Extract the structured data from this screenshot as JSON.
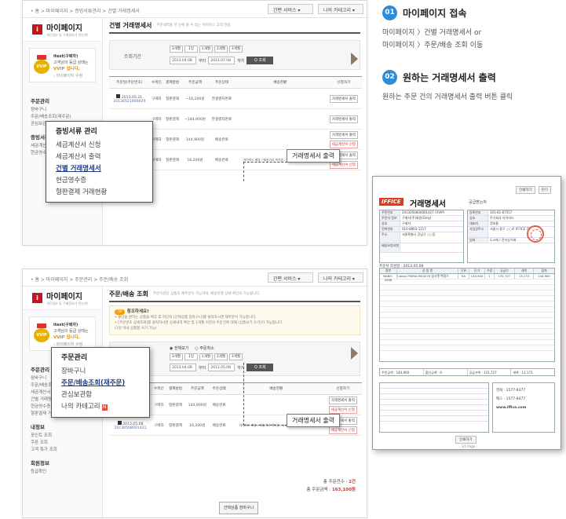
{
  "steps": [
    {
      "num": "01",
      "title": "마이페이지 접속",
      "lines": [
        "마이페이지 〉건별 거래명세서 or",
        "마이페이지 〉주문/배송 조회 이동"
      ]
    },
    {
      "num": "02",
      "title": "원하는 거래명세서 출력",
      "lines": [
        "원하는 주문 건의 거래명세서 출력 버튼 클릭"
      ]
    }
  ],
  "shot1": {
    "breadcrumb": "• 홈 > 마이페이지 > 증빙서류관리 > 건별 거래명세서",
    "top_btn1": "간편 서비스 ▾",
    "top_btn2": "나의 카테고리 ▾",
    "logo_mark": "i",
    "logo_text": "마이페이지",
    "logo_sub": "개인정보 및 구매정보가 한눈에!",
    "user": {
      "name": "itest(구매자)",
      "line2": "고객님의 등급 상태는",
      "grade": "VVIP 입니다.",
      "link": "› 마이페이지 수정"
    },
    "side_h1": "주문관리",
    "side_items1": [
      "장바구니",
      "주문/배송조회(재주문)",
      "관심보관함"
    ],
    "side_h2": "증빙서류",
    "side_items2": [
      "세금계산서",
      "현금영수증"
    ],
    "page_title": "건별 거래명세서",
    "page_sub": "주문내역을 한 눈에 볼 수 있는 아이마스 고객 전용",
    "period_label": "조회기간",
    "period_btns": [
      "3개월",
      "1일",
      "1개월",
      "2개월",
      "3개월"
    ],
    "date_from": "2013.04.08",
    "date_to": "2013.07.08",
    "from_label": "부터",
    "to_label": "까지",
    "query_btn": "Q 조회",
    "columns": [
      "주문일(주문번호)",
      "수취인",
      "결제방법",
      "주문금액",
      "주문상태",
      "배송현황",
      "신청하기"
    ],
    "rows": [
      {
        "date": "2013.05.21",
        "no": "20130521000024",
        "recv": "구매자",
        "pay": "형판결제",
        "amount": "~16,200원",
        "status": "한결결자완료",
        "ship": "",
        "btns": [
          "거래명세서 출력"
        ]
      },
      {
        "date": "",
        "no": "",
        "recv": "구매자",
        "pay": "형판결제",
        "amount": "~144,900원",
        "status": "한결결자완료",
        "ship": "",
        "btns": [
          "거래명세서 출력"
        ]
      },
      {
        "date": "",
        "no": "",
        "recv": "구매자",
        "pay": "형판결제",
        "amount": "144,900원",
        "status": "배송완료",
        "ship": "",
        "btns": [
          "거래명세서 출력",
          "세금계산서 신청"
        ]
      },
      {
        "date": "",
        "no": "",
        "recv": "구매자",
        "pay": "형판결제",
        "amount": "16,200원",
        "status": "배송완료",
        "ship": "아이마스 배송 / 배송기사 박지승 / (H.P.010-8942-3670)",
        "btns": [
          "거래명세서 출력",
          "세금계산서 신청"
        ]
      }
    ],
    "popup_title": "증빙서류 관리",
    "popup_items": [
      "세금계산서 신청",
      "세금계산서 출력",
      "건별 거래명세서",
      "현금영수증",
      "형판결제 거래현황"
    ],
    "callout": "거래명세서 출력"
  },
  "shot2": {
    "breadcrumb": "• 홈 > 마이페이지 > 주문관리 > 주문/배송 조회",
    "top_btn1": "간편 서비스 ▾",
    "top_btn2": "나의 카테고리 ▾",
    "logo_mark": "i",
    "logo_text": "마이페이지",
    "logo_sub": "개인정보 및 구매정보가 한눈에!",
    "user": {
      "name": "itest(구매자)",
      "line2": "고객님의 등급 상태는",
      "grade": "VVIP 입니다.",
      "link": "› 마이페이지 수정"
    },
    "side_h1": "주문관리",
    "side_items1": [
      "장바구니",
      "주문/배송조회",
      "세금계산서 출력",
      "건별 거래명세서",
      "현금영수증",
      "형판결제 거래현황"
    ],
    "side_h2": "내정보",
    "side_items2": [
      "포인트 조회",
      "쿠폰 조회",
      "고객 특가 조회"
    ],
    "side_h3": "회원정보",
    "side_items3": [
      "등급확인"
    ],
    "page_title": "주문/배송 조회",
    "page_sub": "주문하셨던 상품의 재주문이 가능하며, 배송진행 상태 확인이 가능합니다.",
    "tip_tag": "TIP",
    "tip_title": "참조하세요!",
    "tip_lines": [
      "• 출단을 원하는 상품을 체크 후 하단의 [선택상품 장바구니]를 클릭하시면 재주문이 가능합니다.",
      "• [주문번호 상세조회]를 클릭하시면 상세내역 확인 및 1개월 이전의 주문건에 대해 (상품보기 쓰기)가 가능합니다.",
      "(1일 이내 상품평 쓰기 가능)"
    ],
    "radio1": "전체보기",
    "radio2": "주문취소",
    "period_btns": [
      "3개월",
      "1일",
      "1개월",
      "2개월",
      "3개월"
    ],
    "date_from": "2013.04.08",
    "date_to": "2013.05.08",
    "from_label": "부터",
    "to_label": "까지",
    "query_btn": "Q 조회",
    "columns": [
      "주문일(주문번호)",
      "수취인",
      "결제방법",
      "주문금액",
      "주문상태",
      "배송현황",
      "신청하기"
    ],
    "rows": [
      {
        "date": "2013.05.21",
        "no": "20130508001422",
        "recv": "구매자",
        "pay": "형판결제",
        "amount": "144,900원",
        "status": "배송완료",
        "ship": "",
        "btns": [
          "거래명세서 출력",
          "세금계산서 신청"
        ]
      },
      {
        "date": "2013.05.08",
        "no": "20130508001421",
        "recv": "구매자",
        "pay": "형판결제",
        "amount": "16,200원",
        "status": "배송완료",
        "ship": "아이마스 배송 / 배송기사 박지승 / (H.P.010-8942-3670)",
        "btns": [
          "거래명세서 출력",
          "세금계산서 신청"
        ]
      }
    ],
    "total_count_label": "총 주문건수 :",
    "total_count": "2건",
    "total_amount_label": "총 주문금액 :",
    "total_amount": "163,100원",
    "cart_btn": "선택상품 장바구니",
    "popup_title": "주문관리",
    "popup_items": [
      "장바구니",
      "주문/배송조회(재주문)",
      "관심보관함",
      "나의 카테고리"
    ],
    "popup_hot": "N",
    "callout": "거래명세서 출력"
  },
  "invoice": {
    "tool1": "인쇄하기",
    "tool2": "닫기",
    "brand": "IFFICE",
    "title": "거래명세서",
    "no_label": "공급받는자",
    "supplier_rows": [
      {
        "k": "주문번호",
        "v": "2013050800001427 (VVIP)"
      },
      {
        "k": "주문자 정보",
        "v": "구매자(주)회원(Only)"
      },
      {
        "k": "상호",
        "v": "구매자"
      },
      {
        "k": "전화번호",
        "v": "010-8863-1217"
      },
      {
        "k": "주소",
        "v": "서울특별시 강남구 ○○동"
      },
      {
        "k": "배송요청사항",
        "v": ""
      }
    ],
    "right_rows": [
      {
        "k": "등록번호",
        "v": "101-81-67557"
      },
      {
        "k": "상호",
        "v": "주식회사 아이마스"
      },
      {
        "k": "대표자",
        "v": "정보통"
      },
      {
        "k": "사업장주소",
        "v": "서울시 중구 ○○로 IFFICE 7F"
      },
      {
        "k": "업태",
        "v": "도소매 / 전자상거래"
      }
    ],
    "date_line": "주문서 작성일 : 2013.05.08",
    "item_cols": [
      "품번",
      "상 품 명",
      "단위",
      "단가",
      "수량",
      "공급가",
      "세액",
      "합계"
    ],
    "item_first": [
      "NANO-0498",
      "Canon PIXMA MG4270 잉크젯 복합기",
      "EA",
      "144,900",
      "1",
      "131,727",
      "13,173",
      "144,900"
    ],
    "sum_cells": [
      "주문금액 : 144,900",
      "할인금액 : 0",
      "공급가액 : 131,727",
      "세액 : 13,173"
    ],
    "contact_lines": [
      "전화 : 1577-8377",
      "팩스 : 1577-8477",
      "www.iffice.com"
    ],
    "print_btn": "인쇄하기",
    "page": "- 1/1 Page -"
  }
}
